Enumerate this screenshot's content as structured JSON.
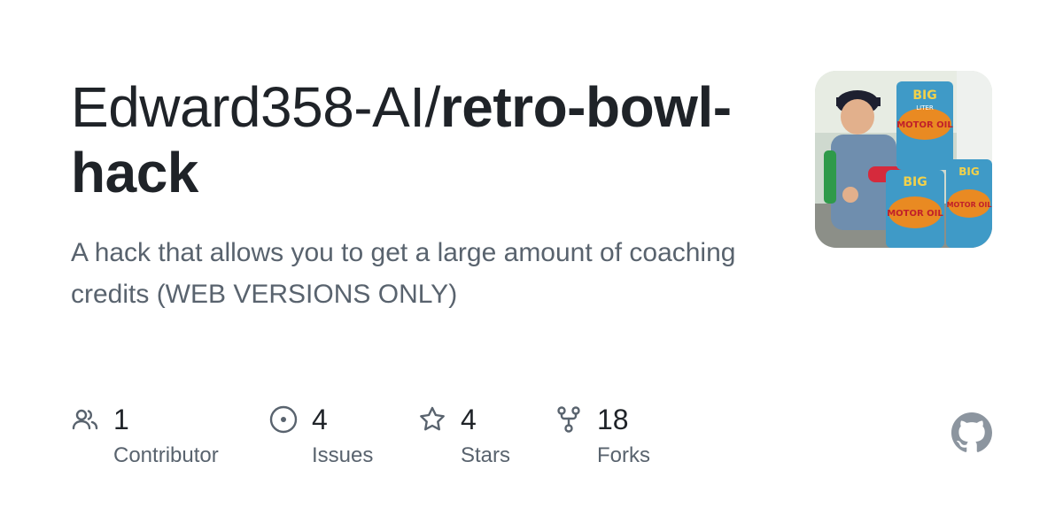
{
  "repo": {
    "owner": "Edward358-AI/",
    "name": "retro-bowl-hack",
    "description": "A hack that allows you to get a large amount of coaching credits (WEB VERSIONS ONLY)"
  },
  "avatar": {
    "content": [
      "BIG",
      "LITER",
      "MOTOR OIL",
      "BIG",
      "MOTOR OIL",
      "BIG",
      "MOTOR OIL"
    ]
  },
  "stats": [
    {
      "icon": "people-icon",
      "value": "1",
      "label": "Contributor"
    },
    {
      "icon": "issue-circle-icon",
      "value": "4",
      "label": "Issues"
    },
    {
      "icon": "star-icon",
      "value": "4",
      "label": "Stars"
    },
    {
      "icon": "fork-icon",
      "value": "18",
      "label": "Forks"
    }
  ],
  "colors": {
    "text": "#1f2328",
    "muted": "#59636e",
    "github_mark": "#8c959f"
  },
  "brand_icon": "github-mark-icon"
}
